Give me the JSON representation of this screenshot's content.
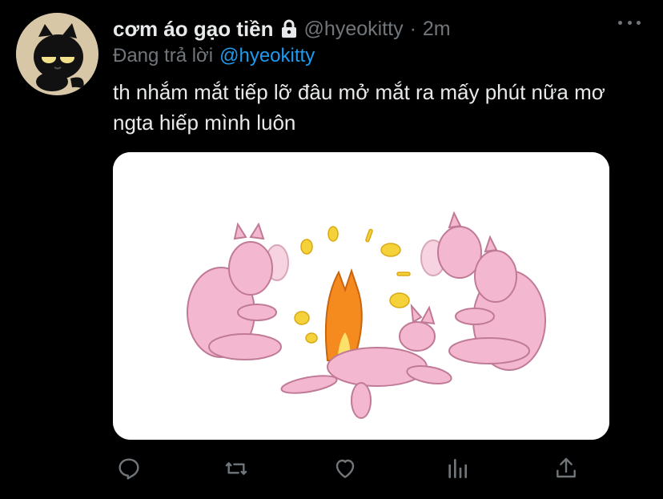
{
  "tweet": {
    "display_name": "cơm áo gạo tiền",
    "handle": "@hyeokitty",
    "separator": "·",
    "time": "2m",
    "reply_prefix": "Đang trả lời",
    "reply_to": "@hyeokitty",
    "text": "th nhắm mắt tiếp lỡ đâu mở mắt ra mấy phút nữa mơ ngta hiếp mình luôn"
  },
  "icons": {
    "avatar": "black-cat-avatar",
    "lock": "lock-icon",
    "more": "more-icon",
    "actions": [
      "reply-icon",
      "retweet-icon",
      "like-icon",
      "analytics-icon",
      "share-icon"
    ]
  },
  "colors": {
    "background": "#000000",
    "text": "#e7e9ea",
    "secondary": "#71767b",
    "accent": "#1d9bf0",
    "media_background": "#ffffff",
    "figure_pink": "#f3b8cf",
    "fire": "#f58a1f",
    "sparkle": "#f5d23a"
  }
}
